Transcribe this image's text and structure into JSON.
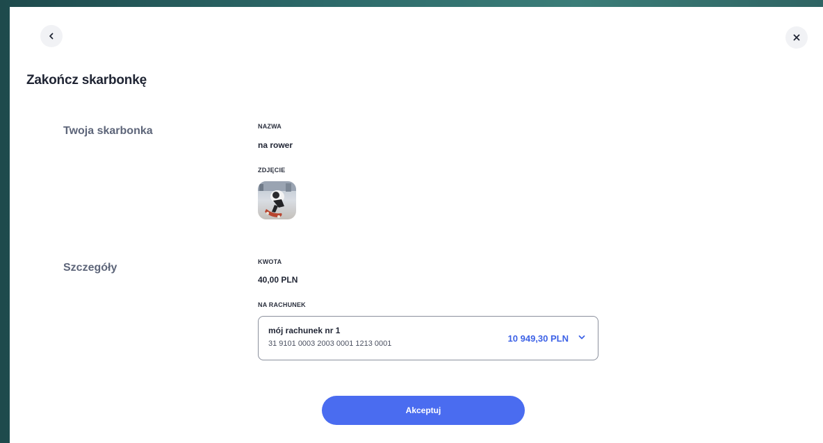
{
  "dialog": {
    "title": "Zakończ skarbonkę"
  },
  "sections": {
    "piggy": {
      "label": "Twoja skarbonka",
      "name_label": "NAZWA",
      "name_value": "na rower",
      "photo_label": "ZDJĘCIE"
    },
    "details": {
      "label": "Szczegóły",
      "amount_label": "KWOTA",
      "amount_value": "40,00 PLN",
      "account_label": "NA RACHUNEK"
    }
  },
  "account": {
    "name": "mój rachunek nr 1",
    "number": "31 9101 0003 2003 0001 1213 0001",
    "balance": "10 949,30 PLN"
  },
  "actions": {
    "accept_label": "Akceptuj"
  },
  "colors": {
    "accent": "#4a6cf0",
    "balance": "#3d62e6",
    "section_label": "#5d6579"
  },
  "icons": {
    "back": "chevron-left-icon",
    "close": "close-icon",
    "dropdown": "chevron-down-icon"
  }
}
